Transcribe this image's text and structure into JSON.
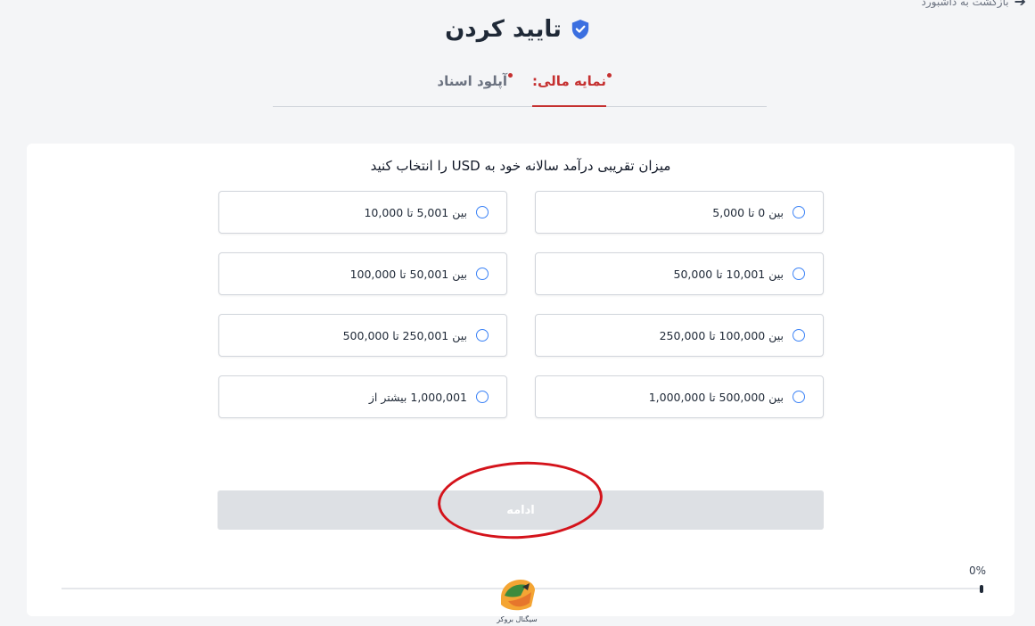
{
  "header": {
    "back_label": "بازگشت به داشبورد",
    "title": "تایید کردن"
  },
  "tabs": [
    {
      "label": "نمایه مالی:",
      "active": true
    },
    {
      "label": "آپلود اسناد",
      "active": false
    }
  ],
  "form": {
    "question": "میزان تقریبی درآمد سالانه خود به USD را انتخاب کنید",
    "options": [
      {
        "label": "بین 0 تا 5,000"
      },
      {
        "label": "بین 5,001 تا 10,000"
      },
      {
        "label": "بین 10,001 تا 50,000"
      },
      {
        "label": "بین 50,001 تا 100,000"
      },
      {
        "label": "بین 100,000 تا 250,000"
      },
      {
        "label": "بین 250,001 تا 500,000"
      },
      {
        "label": "بین 500,000 تا 1,000,000"
      },
      {
        "label": "1,000,001 بیشتر از"
      }
    ],
    "continue_label": "ادامه"
  },
  "progress": {
    "percent_label": "0%",
    "value": 0
  },
  "watermark": {
    "text": "سیگنال بروکر"
  },
  "colors": {
    "accent": "#c53030",
    "radio": "#3b82f6",
    "annotation": "#d4131b",
    "shield": "#3b6fe0"
  }
}
